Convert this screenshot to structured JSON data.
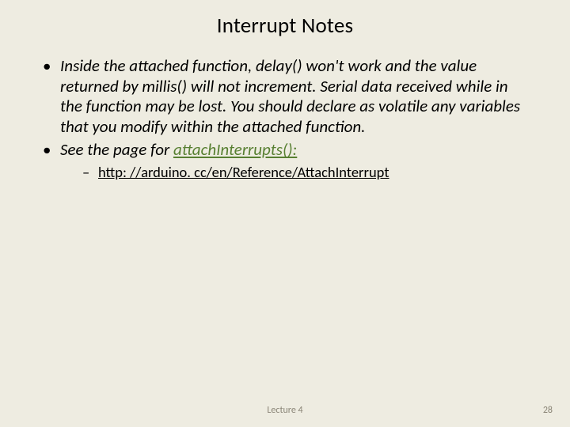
{
  "title": "Interrupt Notes",
  "bullets": {
    "b1": "Inside the attached function, delay() won't work and the value returned by millis() will not increment. Serial data received while in the function may be lost. You should declare as volatile any variables that you modify within the attached function.",
    "b2_prefix": "See the page for ",
    "b2_link": "attachInterrupts():",
    "sub1": "http: //arduino. cc/en/Reference/AttachInterrupt"
  },
  "footer": {
    "center": "Lecture 4",
    "page": "28"
  }
}
